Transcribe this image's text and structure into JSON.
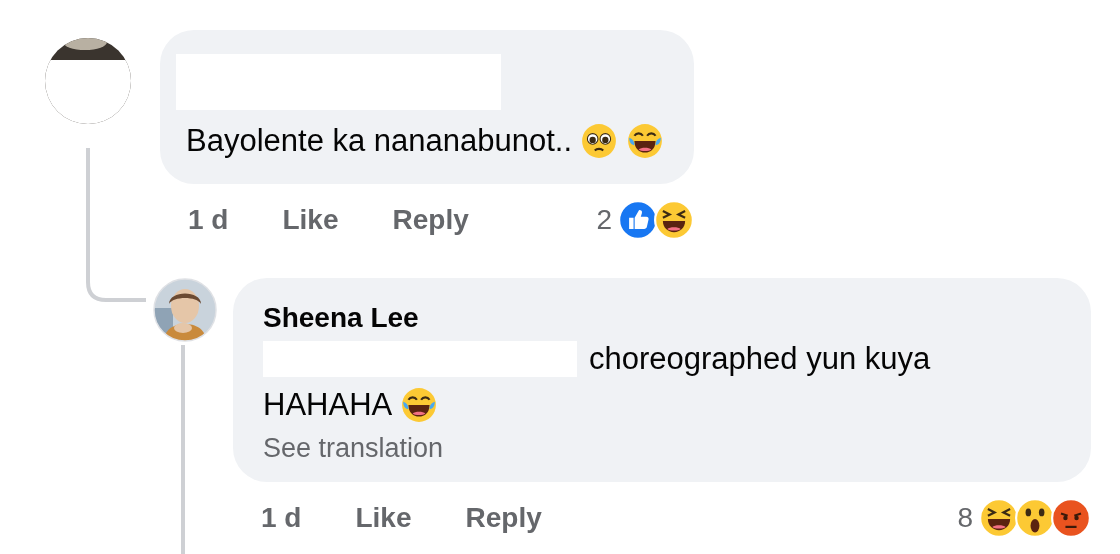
{
  "comments": [
    {
      "text": "Bayolente ka nananabunot..",
      "emojis": [
        {
          "kind": "pleading"
        },
        {
          "kind": "joy"
        }
      ],
      "time": "1 d",
      "like": "Like",
      "reply": "Reply",
      "reaction_count": "2",
      "reactions": [
        {
          "kind": "like"
        },
        {
          "kind": "haha"
        }
      ],
      "replies": [
        {
          "author": "Sheena Lee",
          "text": "choreographed yun kuya",
          "text2": "HAHAHA",
          "emojis": [
            {
              "kind": "joy"
            }
          ],
          "see_translation": "See translation",
          "time": "1 d",
          "like": "Like",
          "reply": "Reply",
          "reaction_count": "8",
          "reactions": [
            {
              "kind": "haha"
            },
            {
              "kind": "wow"
            },
            {
              "kind": "angry"
            }
          ]
        }
      ]
    }
  ]
}
